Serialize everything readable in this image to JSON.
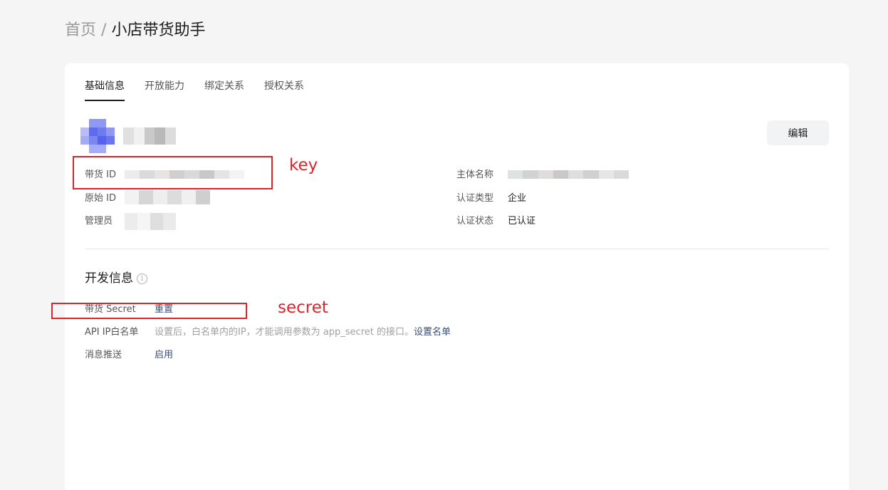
{
  "breadcrumb": {
    "home": "首页",
    "separator": "/",
    "current": "小店带货助手"
  },
  "tabs": [
    {
      "label": "基础信息",
      "active": true
    },
    {
      "label": "开放能力",
      "active": false
    },
    {
      "label": "绑定关系",
      "active": false
    },
    {
      "label": "授权关系",
      "active": false
    }
  ],
  "header": {
    "edit_label": "编辑"
  },
  "info": {
    "daihuo_id_label": "带货 ID",
    "origin_id_label": "原始 ID",
    "admin_label": "管理员",
    "entity_name_label": "主体名称",
    "cert_type_label": "认证类型",
    "cert_type_value": "企业",
    "cert_status_label": "认证状态",
    "cert_status_value": "已认证"
  },
  "dev_info": {
    "title": "开发信息",
    "secret_label": "带货 Secret",
    "secret_action": "重置",
    "ip_whitelist_label": "API IP白名单",
    "ip_whitelist_hint": "设置后，白名单内的IP，才能调用参数为 app_secret 的接口。",
    "ip_whitelist_action": "设置名单",
    "message_push_label": "消息推送",
    "message_push_action": "启用"
  },
  "annotations": {
    "key": "key",
    "secret": "secret"
  },
  "colors": {
    "annotation": "#d9262b",
    "link": "#3a4e7a",
    "avatar": "#6f7cf0"
  }
}
